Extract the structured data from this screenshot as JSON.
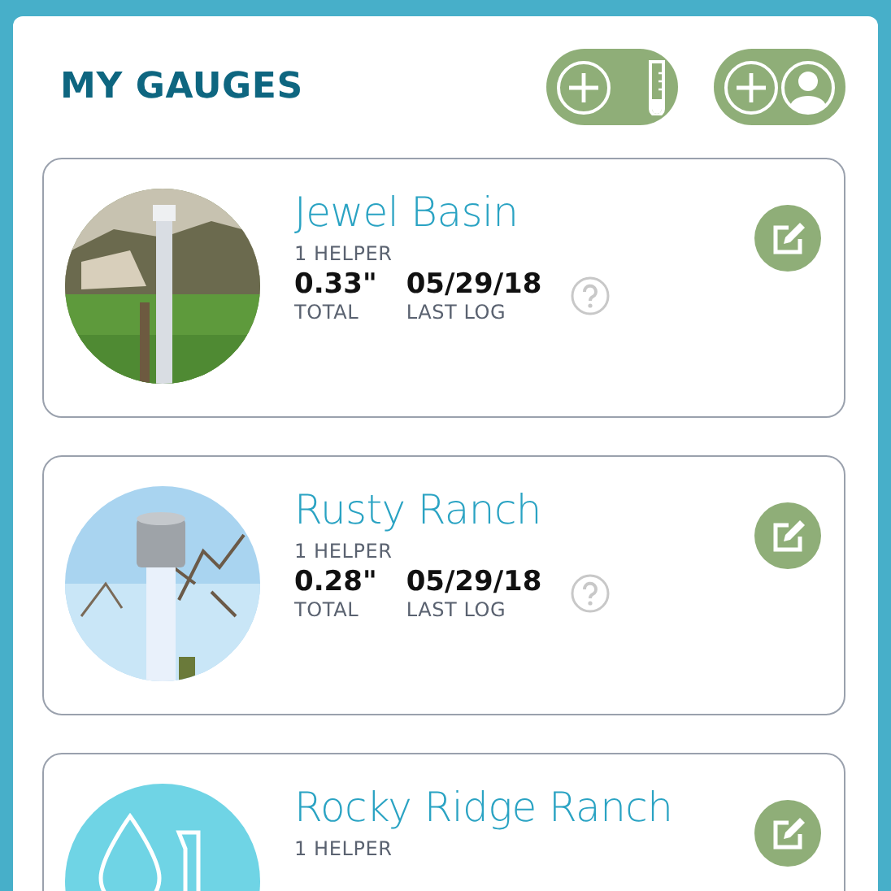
{
  "title": "MY GAUGES",
  "cards": [
    {
      "kind": "picture",
      "name": "Jewel Basin",
      "helpers": "1 HELPER",
      "total": "0.33\"",
      "total_label": "TOTAL",
      "last_log": "05/29/18",
      "last_log_label": "LAST LOG"
    },
    {
      "kind": "picture",
      "name": "Rusty Ranch",
      "helpers": "1 HELPER",
      "total": "0.28\"",
      "total_label": "TOTAL",
      "last_log": "05/29/18",
      "last_log_label": "LAST LOG"
    },
    {
      "kind": "placeholder",
      "name": "Rocky Ridge Ranch",
      "helpers": "1 HELPER"
    }
  ]
}
